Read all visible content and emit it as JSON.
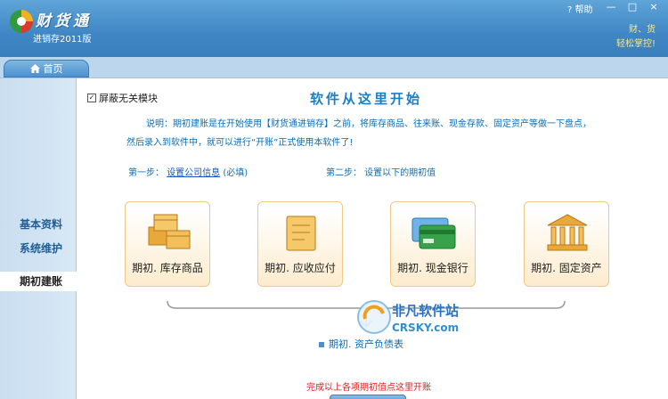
{
  "window": {
    "app_name": "财货通",
    "app_sub": "进销存2011版",
    "help": "? 帮助",
    "minimize": "—",
    "restore": "□",
    "close": "×",
    "slogan_line1": "财、货",
    "slogan_line2": "轻松掌控!"
  },
  "tabs": {
    "home": "首页"
  },
  "sidebar": {
    "items": [
      {
        "label": "基本资料"
      },
      {
        "label": "系统维护"
      },
      {
        "label": "期初建账"
      }
    ]
  },
  "main": {
    "hide_modules": "屏蔽无关模块",
    "headline": "软件从这里开始",
    "desc_line1": "说明：期初建账是在开始使用【财货通进销存】之前，将库存商品、往来账、现金存款、固定资产等做一下盘点，",
    "desc_line2": "然后录入到软件中，就可以进行“开账”正式使用本软件了!",
    "step1_prefix": "第一步：",
    "step1_link": "设置公司信息",
    "step1_suffix": "(必填)",
    "step2": "第二步：   设置以下的期初值",
    "cards": [
      {
        "label": "期初. 库存商品"
      },
      {
        "label": "期初. 应收应付"
      },
      {
        "label": "期初. 现金银行"
      },
      {
        "label": "期初. 固定资产"
      }
    ],
    "result": "期初. 资产负债表",
    "finish": "完成以上各项期初值点这里开账"
  },
  "watermark": {
    "cn": "非凡软件站",
    "en": "CRSKY.com"
  },
  "colors": {
    "title_bar": "#3f86c4",
    "accent_blue": "#1b7fc4",
    "finish_red": "#e02020"
  }
}
